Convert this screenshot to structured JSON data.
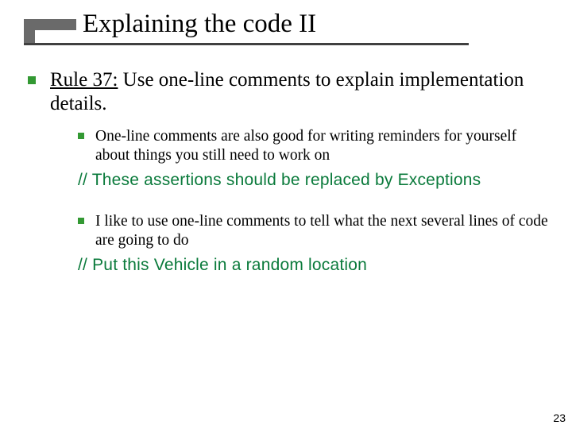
{
  "title": "Explaining the code II",
  "rule": {
    "label": "Rule 37:",
    "text": "Use one-line comments to explain implementation details."
  },
  "sub": [
    {
      "text": "One-line comments are also good for writing reminders for yourself about things you still need to work on",
      "code": "// These assertions should be replaced by Exceptions"
    },
    {
      "text": "I like to use one-line comments to tell what the next several lines of code are going to do",
      "code": "// Put this Vehicle in a random location"
    }
  ],
  "page_number": "23"
}
